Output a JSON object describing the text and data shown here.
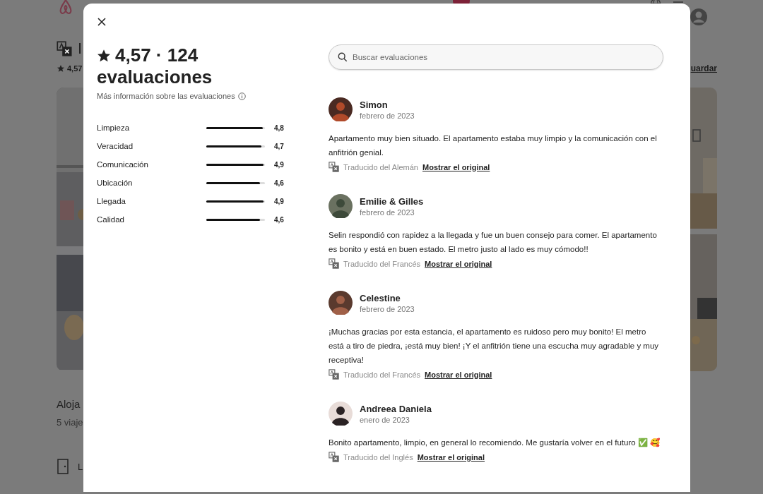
{
  "background_page": {
    "title": "I",
    "rating": "4,57",
    "save_link": "uardar",
    "section_title": "Aloja",
    "section_subtitle": "5 viaje",
    "amenity": "L"
  },
  "modal": {
    "title_rating": "4,57 · 124",
    "title_label": "evaluaciones",
    "info_link": "Más información sobre las evaluaciones",
    "search": {
      "placeholder": "Buscar evaluaciones"
    },
    "categories": [
      {
        "name": "Limpieza",
        "level": 0.96,
        "score": "4,8"
      },
      {
        "name": "Veracidad",
        "level": 0.94,
        "score": "4,7"
      },
      {
        "name": "Comunicación",
        "level": 0.98,
        "score": "4,9"
      },
      {
        "name": "Ubicación",
        "level": 0.92,
        "score": "4,6"
      },
      {
        "name": "Llegada",
        "level": 0.98,
        "score": "4,9"
      },
      {
        "name": "Calidad",
        "level": 0.92,
        "score": "4,6"
      }
    ],
    "reviews": [
      {
        "author": "Simon",
        "date": "febrero de 2023",
        "text": "Apartamento muy bien situado. El apartamento estaba muy limpio y la comunicación con el anfitrión genial.",
        "translation": "Traducido del Alemán",
        "original_link": "Mostrar el original"
      },
      {
        "author": "Emilie & Gilles",
        "date": "febrero de 2023",
        "text": "Selin respondió con rapidez a la llegada y fue un buen consejo para comer. El apartamento es bonito y está en buen estado. El metro justo al lado es muy cómodo!!",
        "translation": "Traducido del Francés",
        "original_link": "Mostrar el original"
      },
      {
        "author": "Celestine",
        "date": "febrero de 2023",
        "text": "¡Muchas gracias por esta estancia, el apartamento es ruidoso pero muy bonito! El metro está a tiro de piedra, ¡está muy bien! ¡Y el anfitrión tiene una escucha muy agradable y muy receptiva!",
        "translation": "Traducido del Francés",
        "original_link": "Mostrar el original"
      },
      {
        "author": "Andreea Daniela",
        "date": "enero de 2023",
        "text": "Bonito apartamento, limpio, en general lo recomiendo. Me gustaría volver en el futuro ✅ 🥰",
        "translation": "Traducido del Inglés",
        "original_link": "Mostrar el original"
      }
    ]
  }
}
